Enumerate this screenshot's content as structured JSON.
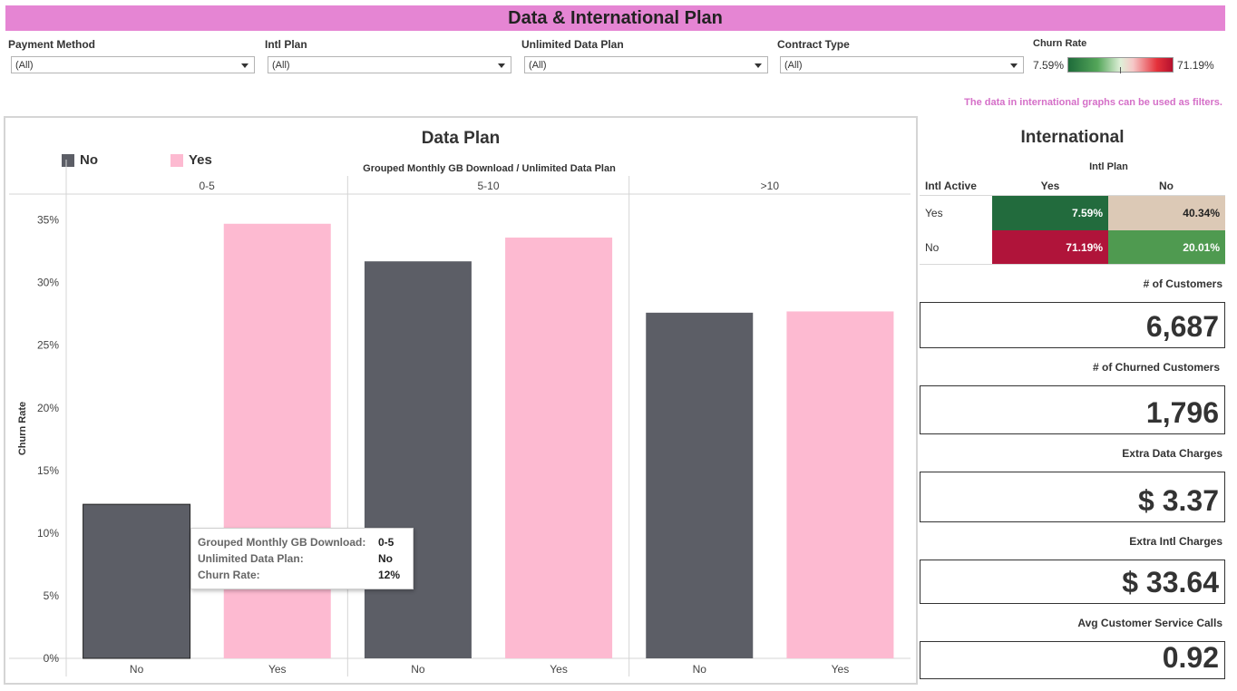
{
  "header": {
    "title": "Data & International Plan"
  },
  "filters": [
    {
      "label": "Payment Method",
      "value": "(All)"
    },
    {
      "label": "Intl Plan",
      "value": "(All)"
    },
    {
      "label": "Unlimited Data Plan",
      "value": "(All)"
    },
    {
      "label": "Contract Type",
      "value": "(All)"
    }
  ],
  "churn_scale": {
    "label": "Churn Rate",
    "min": "7.59%",
    "max": "71.19%"
  },
  "note": "The data in international graphs can be used as filters.",
  "data_plan": {
    "title": "Data Plan",
    "legend": [
      {
        "label": "No",
        "color": "#5c5e66"
      },
      {
        "label": "Yes",
        "color": "#fdbad1"
      }
    ],
    "axis_header": "Grouped Monthly GB Download  /  Unlimited Data Plan"
  },
  "chart_data": {
    "type": "bar",
    "title": "Data Plan",
    "xlabel": "Grouped Monthly GB Download / Unlimited Data Plan",
    "ylabel": "Churn Rate",
    "ylim": [
      0,
      0.37
    ],
    "y_ticks": [
      "0%",
      "5%",
      "10%",
      "15%",
      "20%",
      "25%",
      "30%",
      "35%"
    ],
    "groups": [
      "0-5",
      "5-10",
      ">10"
    ],
    "categories": [
      "No",
      "Yes"
    ],
    "series": [
      {
        "name": "No",
        "color": "#5c5e66",
        "values": [
          0.123,
          0.317,
          0.276
        ]
      },
      {
        "name": "Yes",
        "color": "#fdbad1",
        "values": [
          0.347,
          0.336,
          0.277
        ]
      }
    ],
    "legend_position": "top-left",
    "grid": false
  },
  "tooltip": {
    "rows": [
      {
        "key": "Grouped Monthly GB Download:",
        "value": "0-5"
      },
      {
        "key": "Unlimited Data Plan:",
        "value": "No"
      },
      {
        "key": "Churn Rate:",
        "value": "12%"
      }
    ]
  },
  "international": {
    "title": "International",
    "col_header": "Intl Plan",
    "row_header": "Intl Active",
    "cols": [
      "Yes",
      "No"
    ],
    "rows": [
      {
        "label": "Yes",
        "cells": [
          {
            "value": "7.59%",
            "bg": "#226b3d",
            "fg": "#ffffff"
          },
          {
            "value": "40.34%",
            "bg": "#dcc9b6",
            "fg": "#222222"
          }
        ]
      },
      {
        "label": "No",
        "cells": [
          {
            "value": "71.19%",
            "bg": "#b0143a",
            "fg": "#ffffff"
          },
          {
            "value": "20.01%",
            "bg": "#4f9a50",
            "fg": "#ffffff"
          }
        ]
      }
    ]
  },
  "kpis": [
    {
      "label": "# of Customers",
      "value": "6,687"
    },
    {
      "label": "# of Churned Customers",
      "value": "1,796"
    },
    {
      "label": "Extra Data Charges",
      "value": "$ 3.37"
    },
    {
      "label": "Extra Intl Charges",
      "value": "$ 33.64"
    },
    {
      "label": "Avg Customer Service Calls",
      "value": "0.92"
    }
  ]
}
